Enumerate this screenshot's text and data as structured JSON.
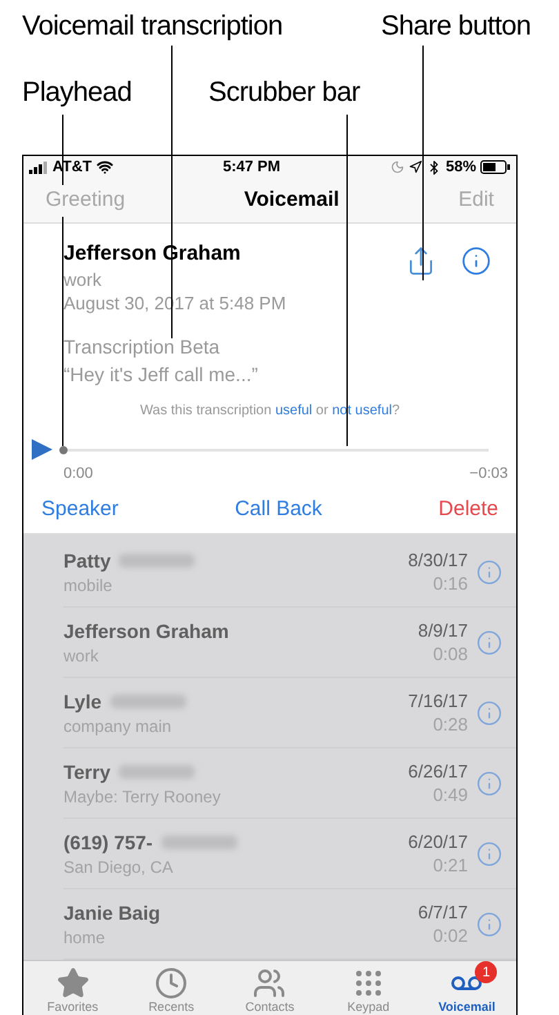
{
  "callouts": [
    {
      "label": "Voicemail transcription"
    },
    {
      "label": "Share button"
    },
    {
      "label": "Playhead"
    },
    {
      "label": "Scrubber bar"
    }
  ],
  "status_bar": {
    "carrier": "AT&T",
    "time": "5:47 PM",
    "battery": "58%"
  },
  "nav": {
    "left": "Greeting",
    "title": "Voicemail",
    "right": "Edit"
  },
  "detail": {
    "name": "Jefferson Graham",
    "label": "work",
    "date": "August 30, 2017 at 5:48 PM",
    "transcription_title": "Transcription Beta",
    "transcription": "“Hey it's Jeff call me...”",
    "feedback_prefix": "Was this transcription",
    "feedback_yes": "useful",
    "feedback_or": "or",
    "feedback_no": "not useful",
    "feedback_suffix": "?",
    "elapsed": "0:00",
    "remaining": "−0:03",
    "level": 0,
    "actions": [
      {
        "label": "Speaker",
        "kind": "normal"
      },
      {
        "label": "Call Back",
        "kind": "normal"
      },
      {
        "label": "Delete",
        "kind": "destructive"
      }
    ]
  },
  "voicemails": [
    {
      "name": "Patty",
      "redacted": true,
      "label": "mobile",
      "date": "8/30/17",
      "duration": "0:16"
    },
    {
      "name": "Jefferson Graham",
      "redacted": false,
      "label": "work",
      "date": "8/9/17",
      "duration": "0:08"
    },
    {
      "name": "Lyle",
      "redacted": true,
      "label": "company main",
      "date": "7/16/17",
      "duration": "0:28"
    },
    {
      "name": "Terry",
      "redacted": true,
      "label": "Maybe: Terry Rooney",
      "date": "6/26/17",
      "duration": "0:49"
    },
    {
      "name": "(619) 757-",
      "redacted": true,
      "label": "San Diego, CA",
      "date": "6/20/17",
      "duration": "0:21"
    },
    {
      "name": "Janie Baig",
      "redacted": false,
      "label": "home",
      "date": "6/7/17",
      "duration": "0:02"
    }
  ],
  "tabs": [
    {
      "label": "Favorites",
      "kind": "star",
      "selected": false
    },
    {
      "label": "Recents",
      "kind": "clock",
      "selected": false
    },
    {
      "label": "Contacts",
      "kind": "contacts",
      "selected": false
    },
    {
      "label": "Keypad",
      "kind": "keypad",
      "selected": false
    },
    {
      "label": "Voicemail",
      "kind": "voicemail",
      "selected": true,
      "badge": "1"
    }
  ]
}
